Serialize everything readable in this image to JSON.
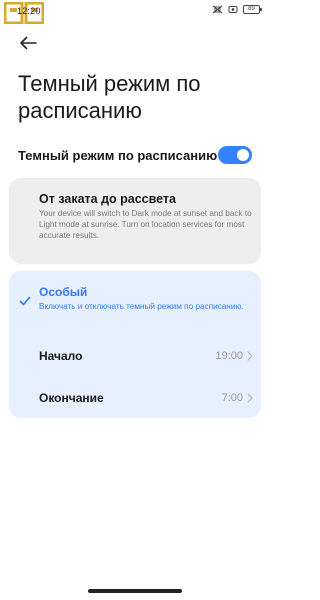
{
  "status_bar": {
    "time": "12:20",
    "battery": "89",
    "icons": [
      "settings-icon",
      "alarm-icon",
      "sim-icon",
      "battery-icon"
    ]
  },
  "header": {
    "back_icon": "arrow-left-icon",
    "title": "Темный режим по расписанию"
  },
  "toggle": {
    "label": "Темный режим по расписанию",
    "on": true
  },
  "options": {
    "sunset": {
      "title": "От заката до рассвета",
      "description": "Your device will switch to Dark mode at sunset and back to Light mode at sunrise. Turn on location services for most accurate results."
    },
    "custom": {
      "title": "Особый",
      "description": "Включать и отключать темный режим по расписанию.",
      "selected": true,
      "start_label": "Начало",
      "start_value": "19:00",
      "end_label": "Окончание",
      "end_value": "7:00"
    }
  },
  "colors": {
    "accent": "#3482ff",
    "accent_text": "#2f7cf6",
    "selected_card_bg": "#e6f0ff",
    "card_bg": "#eeeeee",
    "logo": "#d9a92a"
  }
}
